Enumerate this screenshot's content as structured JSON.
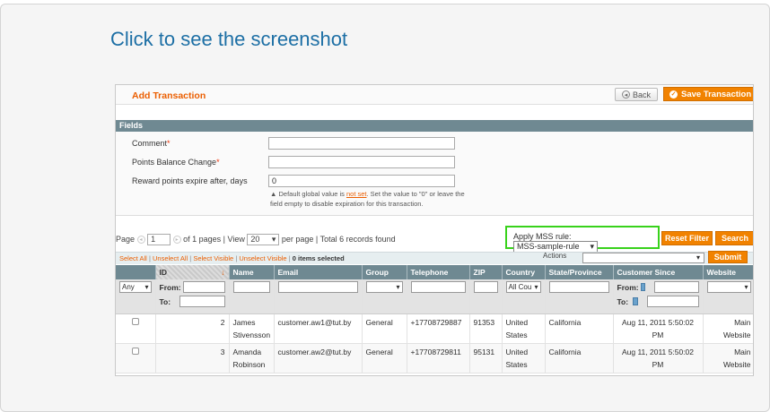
{
  "caption": "Click to see the screenshot",
  "header": {
    "title": "Add Transaction",
    "back_label": "Back",
    "save_label": "Save Transaction"
  },
  "fieldset": {
    "title": "Fields",
    "comment_label": "Comment",
    "points_label": "Points Balance Change",
    "expire_label": "Reward points expire after, days",
    "expire_value": "0",
    "note_pre": "Default global value is ",
    "note_link": "not set",
    "note_post": ". Set the value to \"0\" or leave the field empty to disable expiration for this transaction."
  },
  "pager": {
    "page_label": "Page",
    "page_value": "1",
    "of_pages": "of 1 pages",
    "view_label": "| View",
    "per_page_value": "20",
    "per_page_label": "per page",
    "total": "| Total 6 records found"
  },
  "mss": {
    "label": "Apply MSS rule:",
    "value": "MSS-sample-rule"
  },
  "buttons": {
    "reset": "Reset Filter",
    "search": "Search",
    "submit": "Submit"
  },
  "mass": {
    "select_all": "Select All",
    "unselect_all": "Unselect All",
    "select_visible": "Select Visible",
    "unselect_visible": "Unselect Visible",
    "selected": "0 items selected",
    "actions_label": "Actions"
  },
  "columns": [
    "ID",
    "Name",
    "Email",
    "Group",
    "Telephone",
    "ZIP",
    "Country",
    "State/Province",
    "Customer Since",
    "Website"
  ],
  "filter": {
    "any": "Any",
    "from": "From:",
    "to": "To:",
    "country_value": "All Cou"
  },
  "rows": [
    {
      "id": "2",
      "name": "James Stivensson",
      "email": "customer.aw1@tut.by",
      "group": "General",
      "telephone": "+17708729887",
      "zip": "91353",
      "country": "United States",
      "state": "California",
      "since": "Aug 11, 2011 5:50:02 PM",
      "website": "Main Website"
    },
    {
      "id": "3",
      "name": "Amanda Robinson",
      "email": "customer.aw2@tut.by",
      "group": "General",
      "telephone": "+17708729811",
      "zip": "95131",
      "country": "United States",
      "state": "California",
      "since": "Aug 11, 2011 5:50:02 PM",
      "website": "Main Website"
    }
  ],
  "colors": {
    "accent_orange": "#f18200",
    "header_teal": "#6f8992",
    "mss_highlight": "#38d21b",
    "caption_blue": "#1d6fa5"
  }
}
